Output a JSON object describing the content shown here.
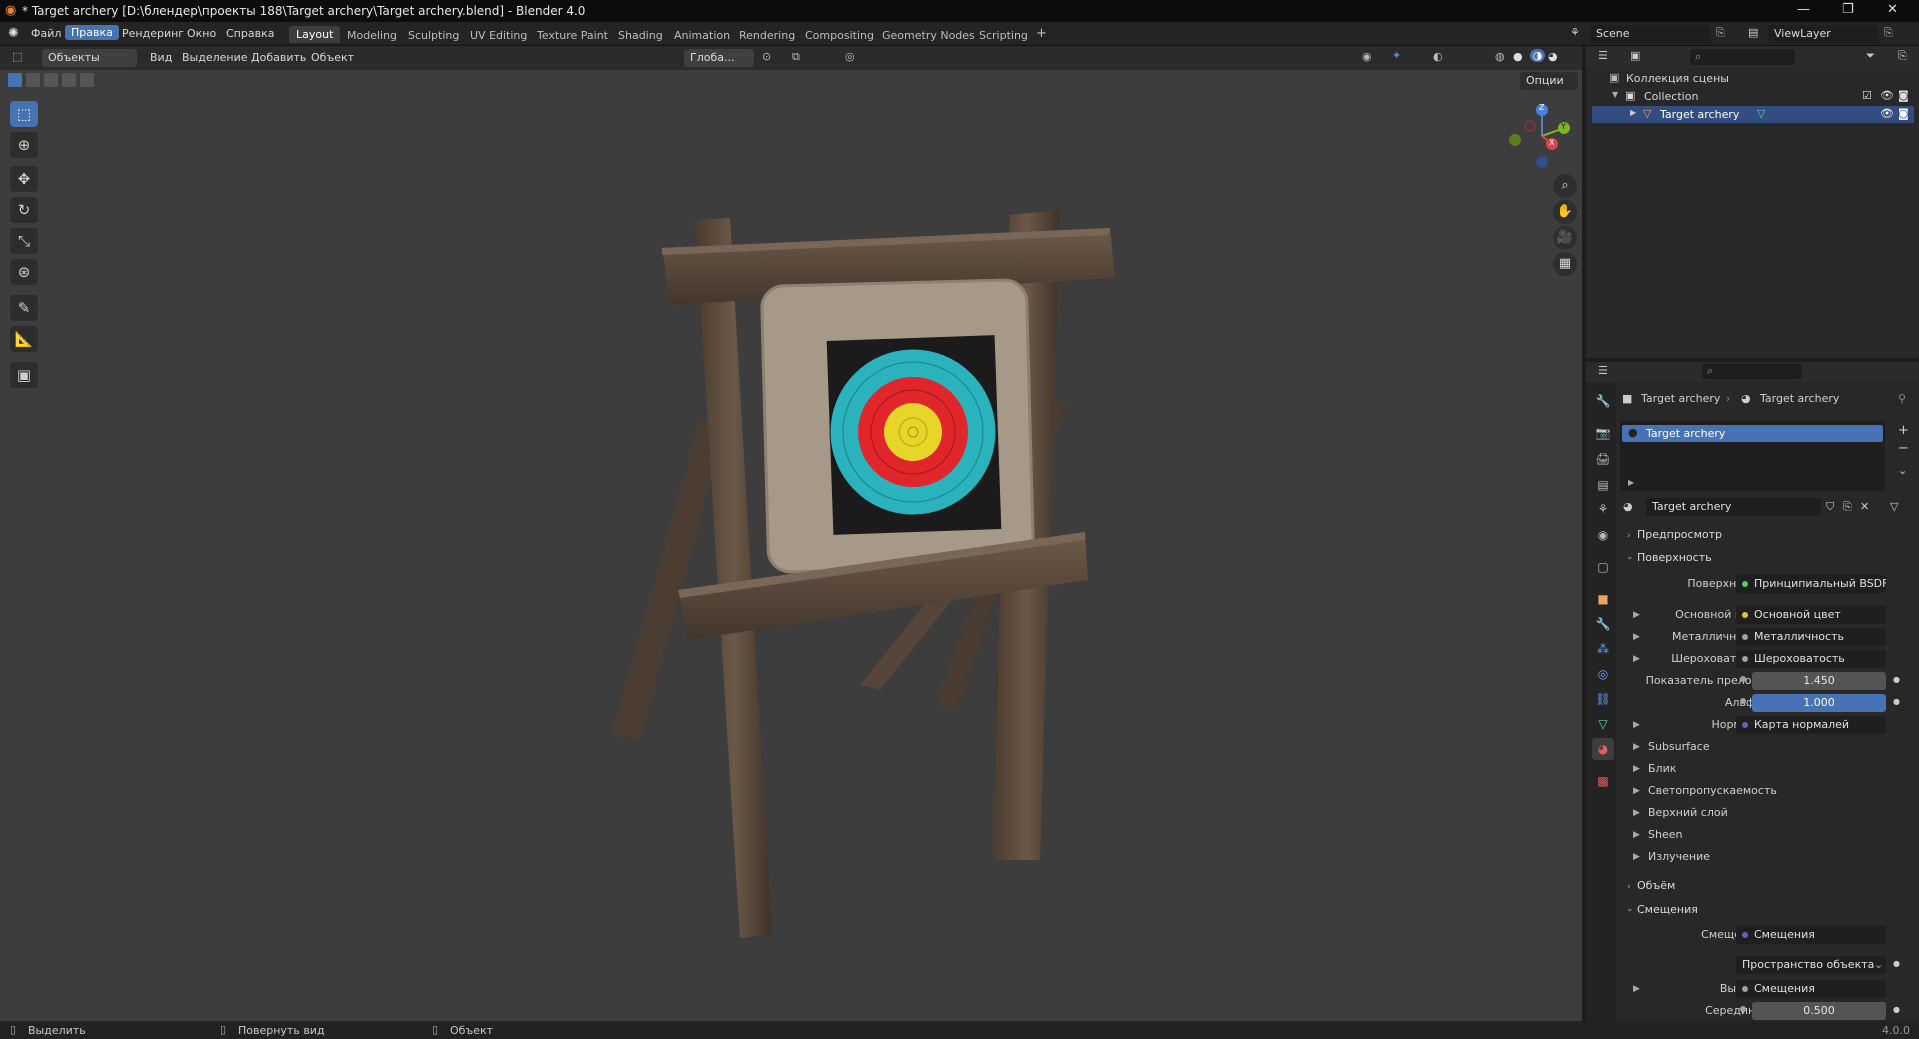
{
  "window": {
    "title": "* Target archery [D:\\блендер\\проекты 188\\Target archery\\Target archery.blend] - Blender 4.0",
    "minimize": "—",
    "maximize": "❐",
    "close": "✕"
  },
  "menu": {
    "items": [
      "Файл",
      "Правка",
      "Рендеринг",
      "Окно",
      "Справка"
    ],
    "active_index": 1
  },
  "workspaces": {
    "tabs": [
      "Layout",
      "Modeling",
      "Sculpting",
      "UV Editing",
      "Texture Paint",
      "Shading",
      "Animation",
      "Rendering",
      "Compositing",
      "Geometry Nodes",
      "Scripting"
    ],
    "active": "Layout",
    "add": "+"
  },
  "scene": {
    "label": "Scene",
    "viewlayer": "ViewLayer"
  },
  "viewport_header": {
    "mode": "Объекты",
    "menus": [
      "Вид",
      "Выделение",
      "Добавить",
      "Объект"
    ],
    "transform_orientation": "Глоба...",
    "options": "Опции"
  },
  "gizmo": {
    "z": "Z",
    "y": "Y",
    "x": "X"
  },
  "outliner": {
    "scene_collection": "Коллекция сцены",
    "collection": "Collection",
    "object": "Target archery"
  },
  "properties": {
    "breadcrumb_object": "Target archery",
    "breadcrumb_material": "Target archery",
    "slot": "Target archery",
    "material_name": "Target archery",
    "sections": {
      "preview": "Предпросмотр",
      "surface": "Поверхность",
      "volume": "Объём",
      "displacement": "Смещения"
    },
    "surface_rows": [
      {
        "label": "Поверхность",
        "value": "Принципиальный BSDF",
        "type": "link",
        "expand": false
      },
      {
        "label": "Основной цвет",
        "value": "Основной цвет",
        "type": "link",
        "expand": true
      },
      {
        "label": "Металличность",
        "value": "Металличность",
        "type": "link",
        "expand": true
      },
      {
        "label": "Шероховатость",
        "value": "Шероховатость",
        "type": "link",
        "expand": true
      },
      {
        "label": "Показатель прело...",
        "value": "1.450",
        "type": "num",
        "expand": false
      },
      {
        "label": "Альфа",
        "value": "1.000",
        "type": "numblue",
        "expand": false
      },
      {
        "label": "Нормаль",
        "value": "Карта нормалей",
        "type": "link",
        "expand": true
      }
    ],
    "subpanels": [
      "Subsurface",
      "Блик",
      "Светопропускаемость",
      "Верхний слой",
      "Sheen",
      "Излучение"
    ],
    "displacement_rows": [
      {
        "label": "Смещения",
        "value": "Смещения",
        "type": "link"
      },
      {
        "label": "",
        "value": "Пространство объекта",
        "type": "dropdown"
      },
      {
        "label": "Высота",
        "value": "Смещения",
        "type": "link"
      },
      {
        "label": "Середина",
        "value": "0.500",
        "type": "num"
      }
    ]
  },
  "statusbar": {
    "select": "Выделить",
    "rotate": "Повернуть вид",
    "object": "Объект",
    "version": "4.0.0"
  }
}
